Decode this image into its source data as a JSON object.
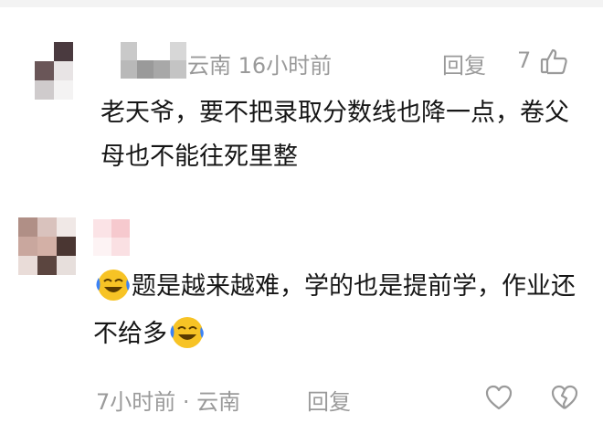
{
  "colors": {
    "text": "#161616",
    "meta": "#9a9a9a",
    "background": "#ffffff",
    "emoji_face": "#f7c325",
    "emoji_tears": "#3b82f6"
  },
  "comments": [
    {
      "location_time": "云南 16小时前",
      "reply_label": "回复",
      "like_count": "7",
      "like_icon": "thumbs-up-icon",
      "text": "老天爷，要不把录取分数线也降一点，卷父母也不能往死里整"
    },
    {
      "text_part1": "题是越来越难，学的也是提前学，作业还不给多",
      "emoji": "face-with-tears-of-joy-icon",
      "time_location": "7小时前 · 云南",
      "reply_label": "回复",
      "like_icon": "heart-icon",
      "dislike_icon": "broken-heart-icon"
    }
  ]
}
